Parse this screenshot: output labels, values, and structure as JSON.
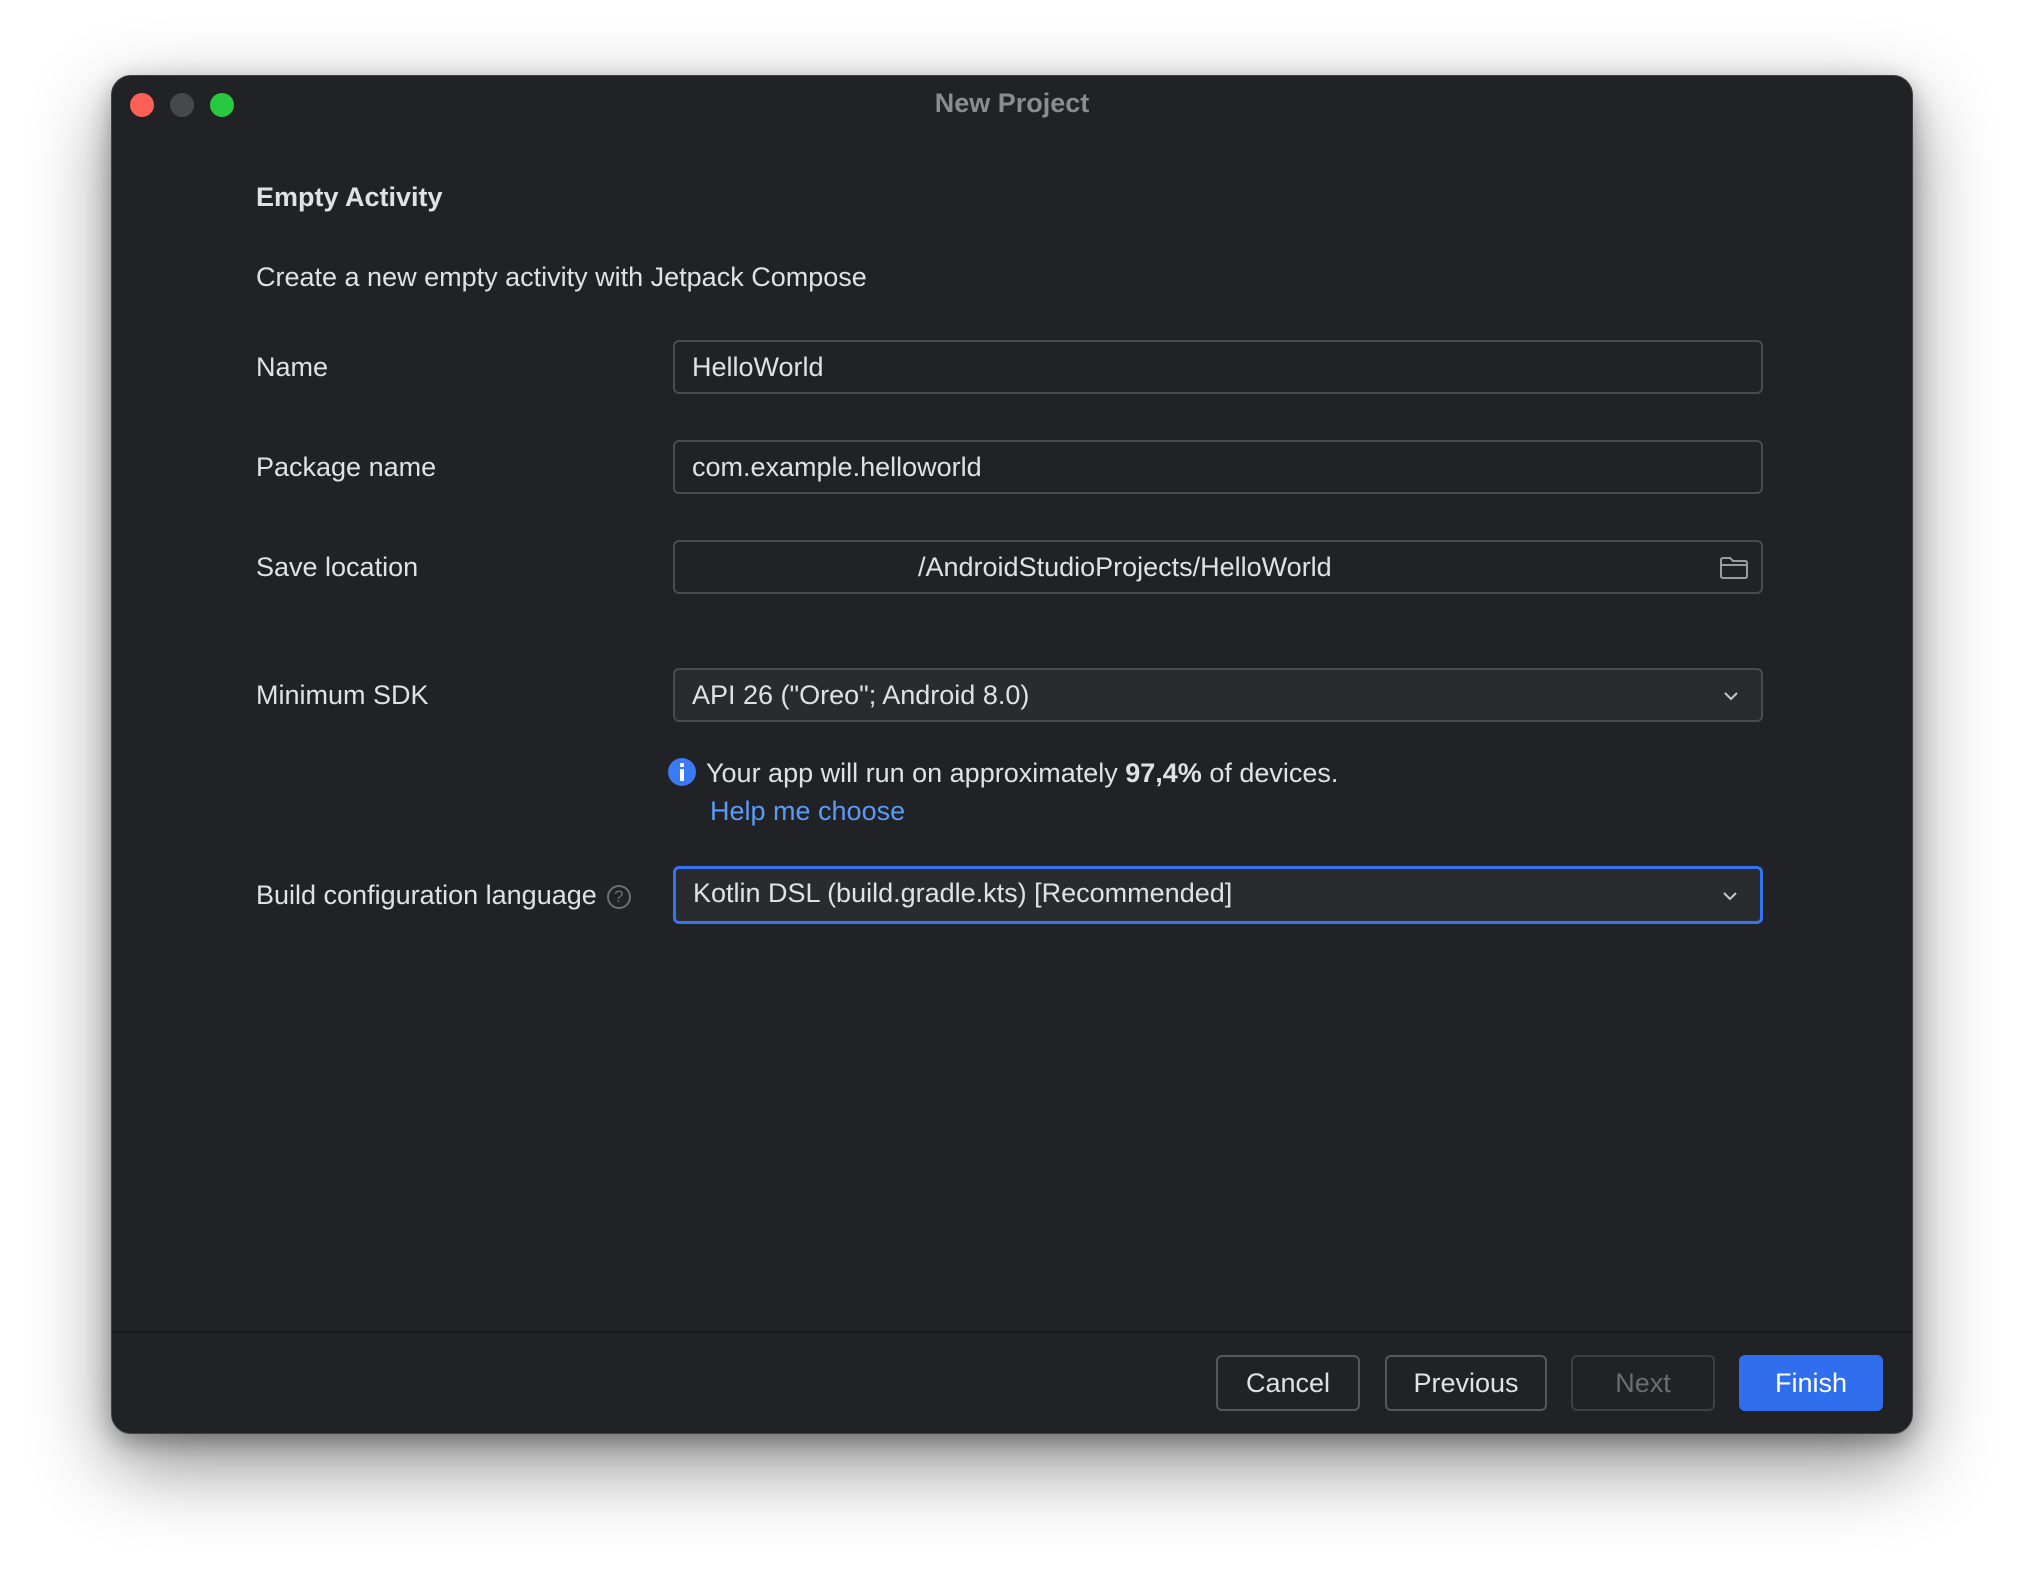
{
  "window": {
    "title": "New Project"
  },
  "form": {
    "heading": "Empty Activity",
    "description": "Create a new empty activity with Jetpack Compose",
    "name": {
      "label": "Name",
      "value": "HelloWorld"
    },
    "package": {
      "label": "Package name",
      "value": "com.example.helloworld"
    },
    "save_location": {
      "label": "Save location",
      "value": "/AndroidStudioProjects/HelloWorld",
      "icon": "folder-icon"
    },
    "min_sdk": {
      "label": "Minimum SDK",
      "value": "API 26 (\"Oreo\"; Android 8.0)",
      "icon": "chevron-down-icon"
    },
    "info": {
      "prefix": "Your app will run on approximately ",
      "percent": "97,4%",
      "suffix": " of devices.",
      "link": "Help me choose"
    },
    "build_lang": {
      "label": "Build configuration language",
      "help": "?",
      "value": "Kotlin DSL (build.gradle.kts) [Recommended]",
      "icon": "chevron-down-icon"
    }
  },
  "footer": {
    "cancel": "Cancel",
    "previous": "Previous",
    "next": "Next",
    "finish": "Finish"
  },
  "colors": {
    "background": "#212225",
    "accent": "#3574f0",
    "link": "#5b9bf8",
    "text": "#dfe1e5"
  }
}
